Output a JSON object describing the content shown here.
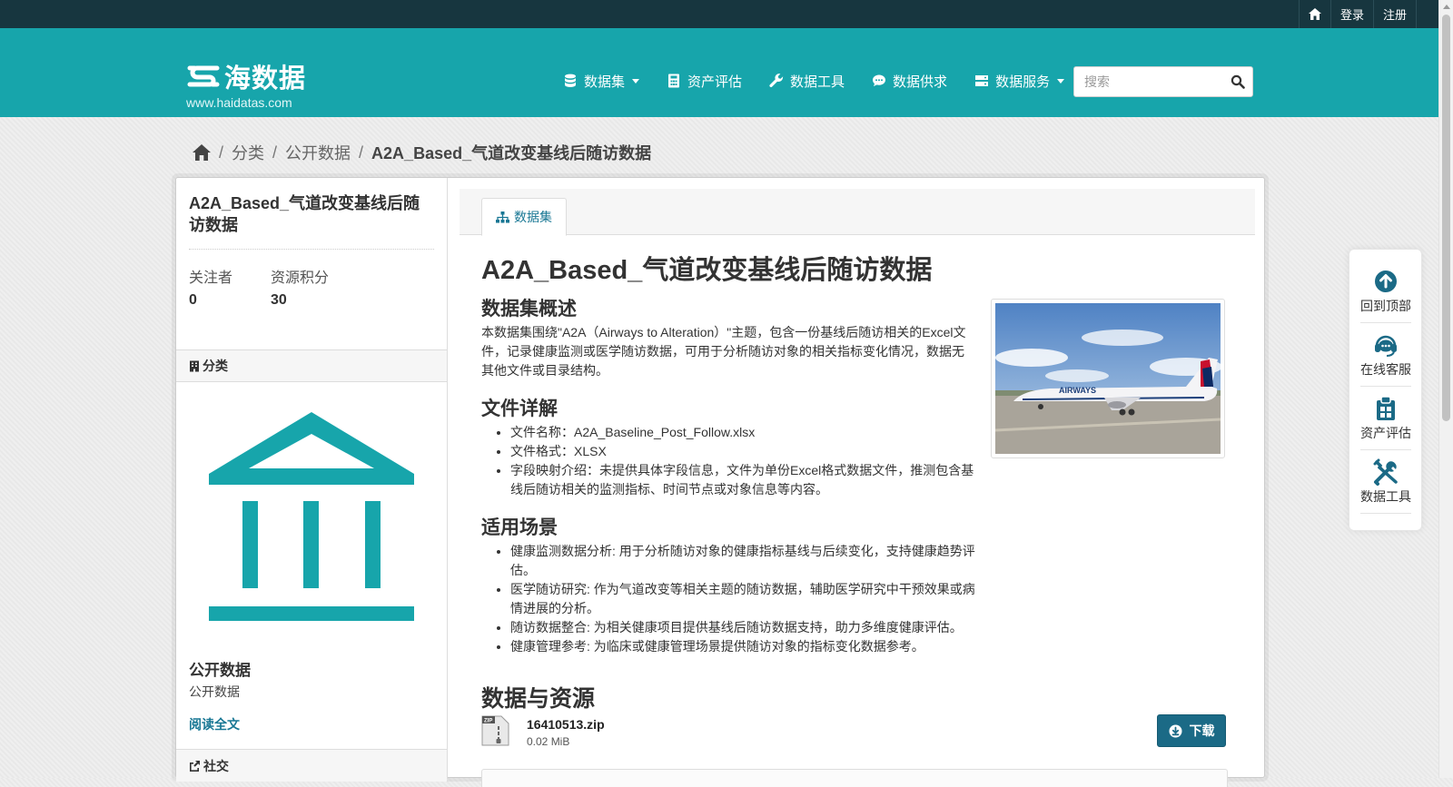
{
  "topbar": {
    "home_icon": "home-icon",
    "login": "登录",
    "register": "注册"
  },
  "brand": {
    "name": "海数据",
    "url": "www.haidatas.com",
    "color": "#17a5ab"
  },
  "nav": [
    {
      "label": "数据集",
      "icon": "database-icon",
      "dropdown": true
    },
    {
      "label": "资产评估",
      "icon": "calculator-icon",
      "dropdown": false
    },
    {
      "label": "数据工具",
      "icon": "wrench-icon",
      "dropdown": false
    },
    {
      "label": "数据供求",
      "icon": "comment-icon",
      "dropdown": false
    },
    {
      "label": "数据服务",
      "icon": "server-icon",
      "dropdown": true
    }
  ],
  "search": {
    "placeholder": "搜索",
    "value": ""
  },
  "breadcrumb": {
    "home_icon": "home-icon",
    "items": [
      "分类",
      "公开数据"
    ],
    "current": "A2A_Based_气道改变基线后随访数据"
  },
  "aside": {
    "title": "A2A_Based_气道改变基线后随访数据",
    "stats": [
      {
        "label": "关注者",
        "value": "0"
      },
      {
        "label": "资源积分",
        "value": "30"
      }
    ],
    "category_heading": "分类",
    "org_name": "公开数据",
    "org_desc": "公开数据",
    "read_more": "阅读全文",
    "social_heading": "社交"
  },
  "tab": {
    "label": "数据集"
  },
  "dataset": {
    "title": "A2A_Based_气道改变基线后随访数据",
    "overview_heading": "数据集概述",
    "overview": "本数据集围绕\"A2A（Airways to Alteration）\"主题，包含一份基线后随访相关的Excel文件，记录健康监测或医学随访数据，可用于分析随访对象的相关指标变化情况，数据无其他文件或目录结构。",
    "file_heading": "文件详解",
    "file_items": [
      "文件名称：A2A_Baseline_Post_Follow.xlsx",
      "文件格式：XLSX",
      "字段映射介绍：未提供具体字段信息，文件为单份Excel格式数据文件，推测包含基线后随访相关的监测指标、时间节点或对象信息等内容。"
    ],
    "usage_heading": "适用场景",
    "usage_items": [
      "健康监测数据分析: 用于分析随访对象的健康指标基线与后续变化，支持健康趋势评估。",
      "医学随访研究: 作为气道改变等相关主题的随访数据，辅助医学研究中干预效果或病情进展的分析。",
      "随访数据整合: 为相关健康项目提供基线后随访数据支持，助力多维度健康评估。",
      "健康管理参考: 为临床或健康管理场景提供随访对象的指标变化数据参考。"
    ],
    "resources_heading": "数据与资源",
    "resource": {
      "name": "16410513.zip",
      "size": "0.02 MiB",
      "download": "下载",
      "type_icon": "zip-file-icon"
    }
  },
  "float_panel": [
    {
      "label": "回到顶部",
      "icon": "arrow-up-circle-icon"
    },
    {
      "label": "在线客服",
      "icon": "headset-icon"
    },
    {
      "label": "资产评估",
      "icon": "clipboard-icon"
    },
    {
      "label": "数据工具",
      "icon": "tools-icon"
    }
  ],
  "colors": {
    "topbar": "#17363f",
    "accent": "#17a5ab",
    "link": "#187794",
    "button": "#1b6a86"
  }
}
